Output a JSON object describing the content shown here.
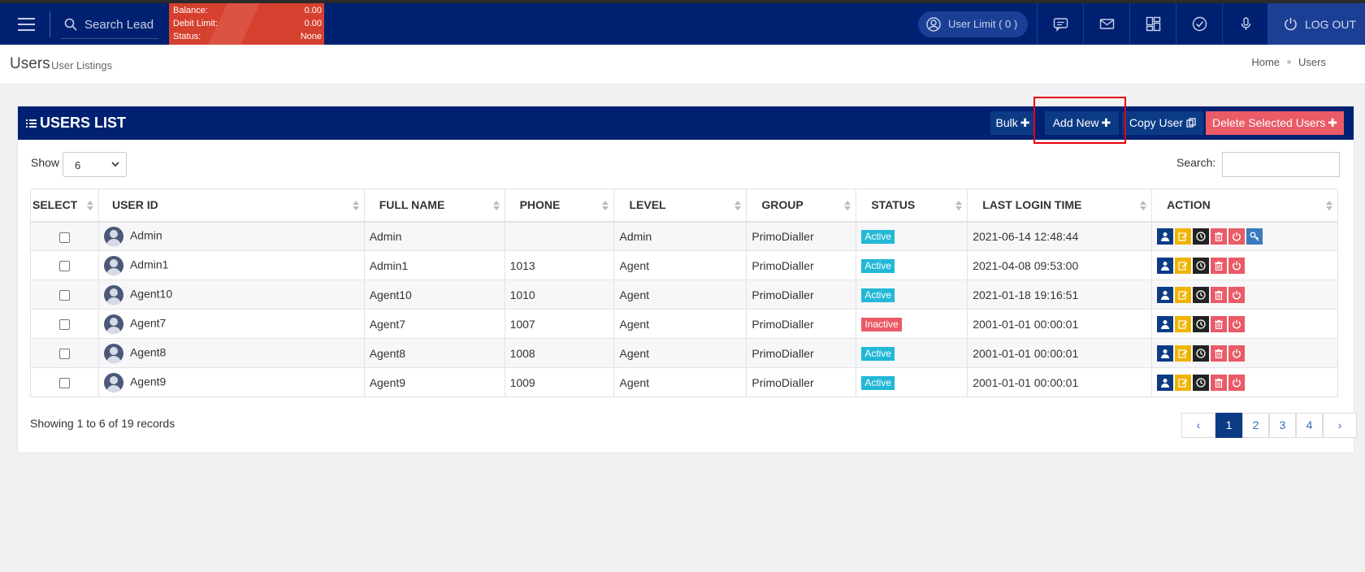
{
  "header": {
    "search_placeholder": "Search Lead",
    "balance": {
      "label": "Balance:",
      "value": "0.00"
    },
    "debit_limit": {
      "label": "Debit Limit:",
      "value": "0.00"
    },
    "status": {
      "label": "Status:",
      "value": "None"
    },
    "user_limit": "User Limit ( 0 )",
    "logout": "LOG OUT",
    "colors": {
      "navbar": "#002171",
      "balance_box": "#d6402e"
    }
  },
  "page": {
    "title": "Users",
    "subtitle": "User Listings",
    "breadcrumbs": [
      "Home",
      "Users"
    ]
  },
  "card": {
    "title": "USERS LIST",
    "buttons": {
      "bulk": "Bulk",
      "add_new": "Add New",
      "copy_user": "Copy User",
      "delete_selected": "Delete Selected Users"
    },
    "show_label": "Show",
    "show_value": "6",
    "search_label": "Search:",
    "columns": [
      "SELECT",
      "USER ID",
      "FULL NAME",
      "PHONE",
      "LEVEL",
      "GROUP",
      "STATUS",
      "LAST LOGIN TIME",
      "ACTION"
    ],
    "rows": [
      {
        "user_id": "Admin",
        "full_name": "Admin",
        "phone": "",
        "level": "Admin",
        "group": "PrimoDialler",
        "status": "Active",
        "last_login": "2021-06-14 12:48:44"
      },
      {
        "user_id": "Admin1",
        "full_name": "Admin1",
        "phone": "1013",
        "level": "Agent",
        "group": "PrimoDialler",
        "status": "Active",
        "last_login": "2021-04-08 09:53:00"
      },
      {
        "user_id": "Agent10",
        "full_name": "Agent10",
        "phone": "1010",
        "level": "Agent",
        "group": "PrimoDialler",
        "status": "Active",
        "last_login": "2021-01-18 19:16:51"
      },
      {
        "user_id": "Agent7",
        "full_name": "Agent7",
        "phone": "1007",
        "level": "Agent",
        "group": "PrimoDialler",
        "status": "Inactive",
        "last_login": "2001-01-01 00:00:01"
      },
      {
        "user_id": "Agent8",
        "full_name": "Agent8",
        "phone": "1008",
        "level": "Agent",
        "group": "PrimoDialler",
        "status": "Active",
        "last_login": "2001-01-01 00:00:01"
      },
      {
        "user_id": "Agent9",
        "full_name": "Agent9",
        "phone": "1009",
        "level": "Agent",
        "group": "PrimoDialler",
        "status": "Active",
        "last_login": "2001-01-01 00:00:01"
      }
    ],
    "showing_text": "Showing 1 to 6 of 19 records",
    "pagination": {
      "prev": "‹",
      "pages": [
        "1",
        "2",
        "3",
        "4"
      ],
      "next": "›",
      "current": "1"
    },
    "colors": {
      "active": "#22b8d6",
      "inactive": "#ea5a67",
      "primary": "#0c3b86"
    }
  }
}
